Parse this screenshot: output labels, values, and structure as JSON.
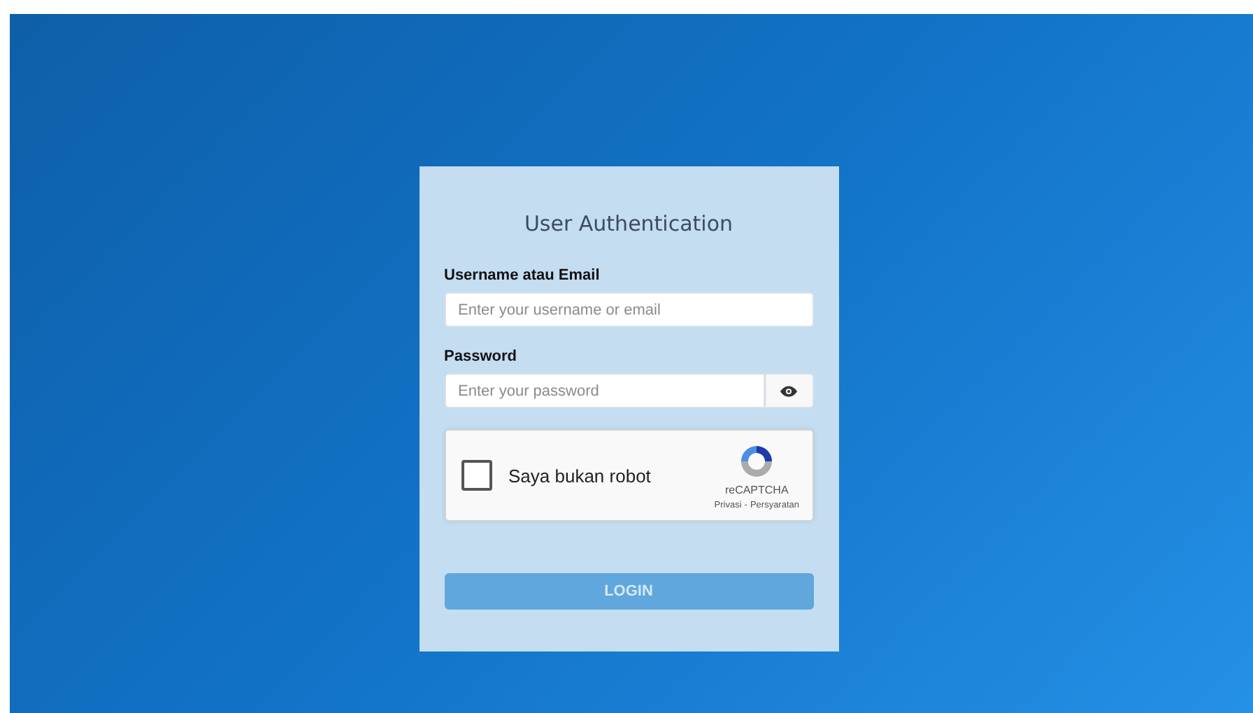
{
  "login_card": {
    "title": "User Authentication",
    "fields": [
      {
        "label": "Username atau Email",
        "placeholder": "Enter your username or email",
        "kind": "text"
      },
      {
        "label": "Password",
        "placeholder": "Enter your password",
        "kind": "password"
      }
    ],
    "captcha": {
      "label": "Saya bukan robot",
      "checked": false,
      "brand": "reCAPTCHA",
      "links": [
        "Privasi",
        "Persyaratan"
      ],
      "separator": "-"
    },
    "login_button": {
      "label": "LOGIN",
      "disabled": true
    }
  }
}
